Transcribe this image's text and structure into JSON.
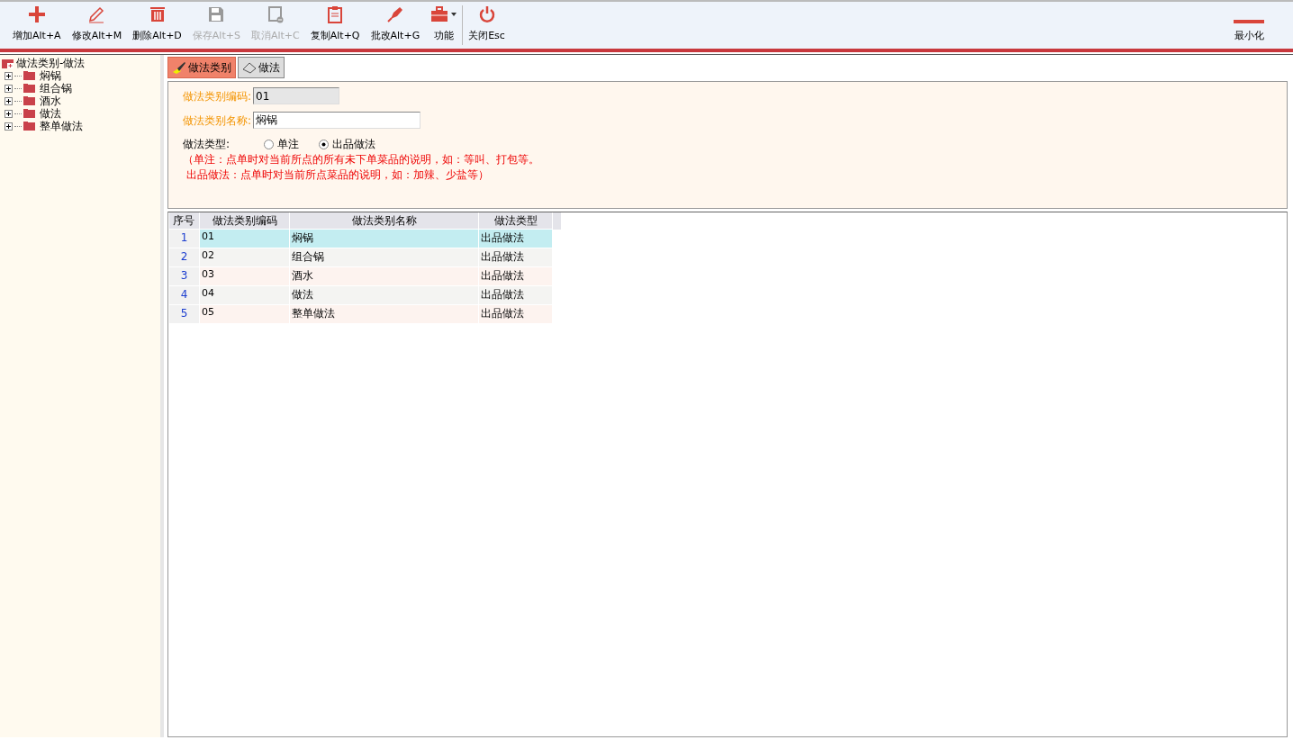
{
  "toolbar": {
    "buttons": [
      {
        "label": "增加Alt+A",
        "disabled": false,
        "has_menu": false
      },
      {
        "label": "修改Alt+M",
        "disabled": false,
        "has_menu": false
      },
      {
        "label": "删除Alt+D",
        "disabled": false,
        "has_menu": false
      },
      {
        "label": "保存Alt+S",
        "disabled": true,
        "has_menu": false
      },
      {
        "label": "取消Alt+C",
        "disabled": true,
        "has_menu": false
      },
      {
        "label": "复制Alt+Q",
        "disabled": false,
        "has_menu": false
      },
      {
        "label": "批改Alt+G",
        "disabled": false,
        "has_menu": false
      },
      {
        "label": "功能",
        "disabled": false,
        "has_menu": true
      },
      {
        "label": "关闭Esc",
        "disabled": false,
        "has_menu": false
      }
    ],
    "minimize": {
      "label": "最小化"
    }
  },
  "tree": {
    "label": "做法类别-做法",
    "expanded": true,
    "children": [
      {
        "label": "焖锅",
        "expanded": false
      },
      {
        "label": "组合锅",
        "expanded": false
      },
      {
        "label": "酒水",
        "expanded": false
      },
      {
        "label": "做法",
        "expanded": false
      },
      {
        "label": "整单做法",
        "expanded": false
      }
    ]
  },
  "tabs": [
    {
      "label": "做法类别",
      "selected": true
    },
    {
      "label": "做法",
      "selected": false
    }
  ],
  "form": {
    "code": {
      "label": "做法类别编码:",
      "value": "01"
    },
    "name": {
      "label": "做法类别名称:",
      "value": "焖锅"
    },
    "type": {
      "label": "做法类型:",
      "options": [
        {
          "label": "单注",
          "selected": false
        },
        {
          "label": "出品做法",
          "selected": true
        }
      ]
    },
    "notes": [
      "（单注：点单时对当前所点的所有未下单菜品的说明，如：等叫、打包等。",
      "出品做法：点单时对当前所点菜品的说明，如：加辣、少盐等）"
    ]
  },
  "table": {
    "columns": [
      "序号",
      "做法类别编码",
      "做法类别名称",
      "做法类型"
    ],
    "rows": [
      {
        "cells": [
          "1",
          "01",
          "焖锅",
          "出品做法"
        ],
        "selected": true
      },
      {
        "cells": [
          "2",
          "02",
          "组合锅",
          "出品做法"
        ],
        "selected": false
      },
      {
        "cells": [
          "3",
          "03",
          "酒水",
          "出品做法"
        ],
        "selected": false
      },
      {
        "cells": [
          "4",
          "04",
          "做法",
          "出品做法"
        ],
        "selected": false
      },
      {
        "cells": [
          "5",
          "05",
          "整单做法",
          "出品做法"
        ],
        "selected": false
      }
    ]
  }
}
